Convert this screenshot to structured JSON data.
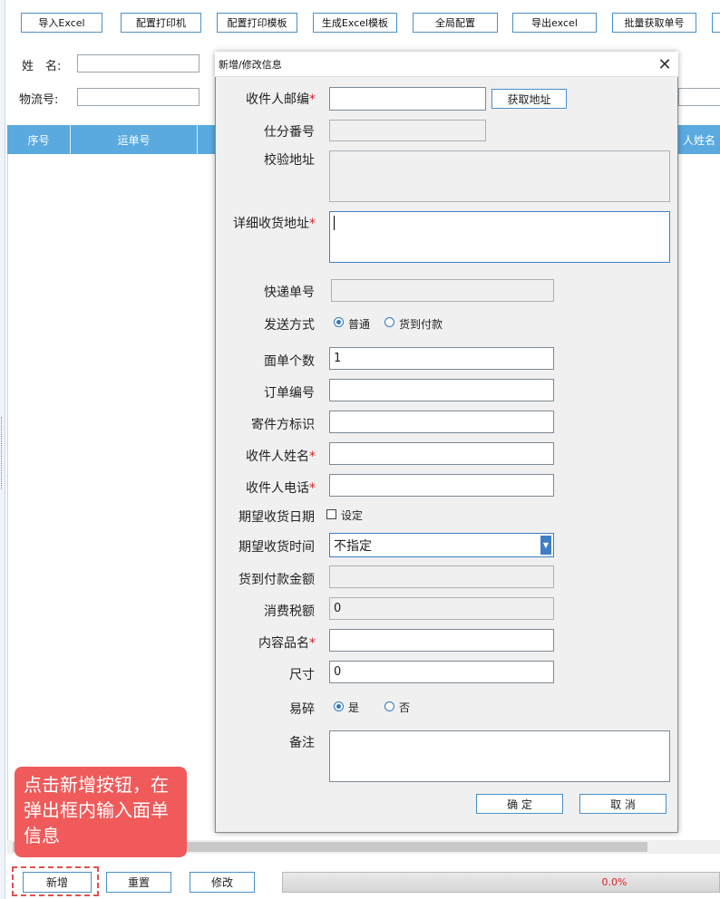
{
  "toolbar": {
    "import_excel": "导入Excel",
    "config_printer": "配置打印机",
    "config_template": "配置打印模板",
    "gen_template": "生成Excel模板",
    "global_config": "全局配置",
    "export_excel": "导出excel",
    "batch_get": "批量获取单号"
  },
  "filters": {
    "name_label": "姓　名:",
    "tracking_label": "物流号:"
  },
  "grid": {
    "col_index": "序号",
    "col_waybill": "运单号",
    "col_recipient": "人姓名"
  },
  "dialog": {
    "title": "新增/修改信息",
    "close": "✕",
    "postcode_label": "收件人邮编",
    "get_address": "获取地址",
    "sort_code_label": "仕分番号",
    "verify_addr_label": "校验地址",
    "detail_addr_label": "详细收货地址",
    "express_no_label": "快递单号",
    "send_method_label": "发送方式",
    "send_normal": "普通",
    "send_cod": "货到付款",
    "sheet_count_label": "面单个数",
    "sheet_count_value": "1",
    "order_no_label": "订单编号",
    "sender_id_label": "寄件方标识",
    "recipient_name_label": "收件人姓名",
    "recipient_phone_label": "收件人电话",
    "exp_date_label": "期望收货日期",
    "exp_date_check": "设定",
    "exp_time_label": "期望收货时间",
    "exp_time_value": "不指定",
    "cod_amount_label": "货到付款金额",
    "tax_label": "消费税额",
    "tax_value": "0",
    "content_label": "内容品名",
    "size_label": "尺寸",
    "size_value": "0",
    "fragile_label": "易碎",
    "fragile_yes": "是",
    "fragile_no": "否",
    "remark_label": "备注",
    "required_mark": "*",
    "ok": "确 定",
    "cancel": "取 消"
  },
  "bottom": {
    "add": "新增",
    "reset": "重置",
    "edit": "修改",
    "progress": "0.0%"
  },
  "tip": {
    "text": "点击新增按钮，在弹出框内输入面单信息"
  },
  "colors": {
    "header_blue": "#5aaae0",
    "button_border": "#4a90c8",
    "required_red": "#d62222",
    "tip_red": "#f05a5a"
  }
}
